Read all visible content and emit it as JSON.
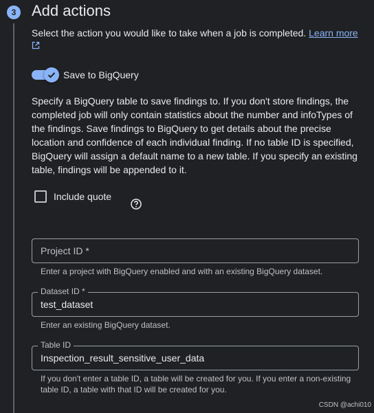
{
  "step": {
    "number": "3",
    "title": "Add actions"
  },
  "intro": {
    "text": "Select the action you would like to take when a job is completed.",
    "learn_more": "Learn more",
    "external_icon": "open-in-new-icon"
  },
  "save_toggle": {
    "label": "Save to BigQuery",
    "enabled": true,
    "description": "Specify a BigQuery table to save findings to. If you don't store findings, the completed job will only contain statistics about the number and infoTypes of the findings. Save findings to BigQuery to get details about the precise location and confidence of each individual finding. If no table ID is specified, BigQuery will assign a default name to a new table. If you specify an existing table, findings will be appended to it."
  },
  "include_quote": {
    "label": "Include quote",
    "checked": false,
    "help_icon": "help-circle-icon"
  },
  "fields": {
    "project_id": {
      "placeholder": "Project ID *",
      "value": "",
      "hint": "Enter a project with BigQuery enabled and with an existing BigQuery dataset."
    },
    "dataset_id": {
      "label": "Dataset ID *",
      "value": "test_dataset",
      "hint": "Enter an existing BigQuery dataset."
    },
    "table_id": {
      "label": "Table ID",
      "value": "Inspection_result_sensitive_user_data",
      "hint": "If you don't enter a table ID, a table will be created for you. If you enter a non-existing table ID, a table with that ID will be created for you."
    }
  },
  "watermark": "CSDN @achi010",
  "colors": {
    "background": "#202124",
    "accent": "#8ab4f8",
    "text": "#e8eaed",
    "muted": "#bdc1c6",
    "border": "#9aa0a6"
  }
}
